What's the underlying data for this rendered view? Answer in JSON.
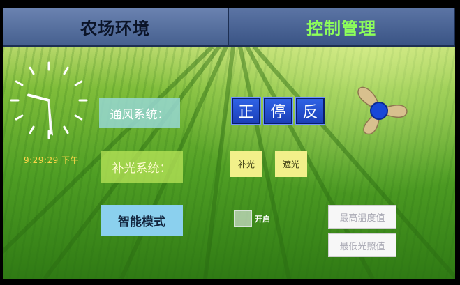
{
  "tabs": {
    "farm_env": "农场环境",
    "control": "控制管理"
  },
  "clock": {
    "time_text": "9:29:29 下午",
    "hour": 9,
    "minute": 29,
    "second": 29
  },
  "ventilation": {
    "label": "通风系统：",
    "forward": "正",
    "stop": "停",
    "reverse": "反"
  },
  "lighting": {
    "label": "补光系统：",
    "fill": "补光",
    "shade": "遮光"
  },
  "smart_mode": {
    "label": "智能模式",
    "enable_label": "开启",
    "enabled": false
  },
  "thresholds": {
    "max_temp": "最高温度值",
    "min_light": "最低光照值"
  },
  "colors": {
    "accent_tab_text": "#8dff5a",
    "button_blue": "#2f63e6",
    "button_yellow": "#f2f08a",
    "time_text": "#ffd54a"
  },
  "icons": {
    "fan": "fan-icon",
    "clock": "analog-clock"
  }
}
